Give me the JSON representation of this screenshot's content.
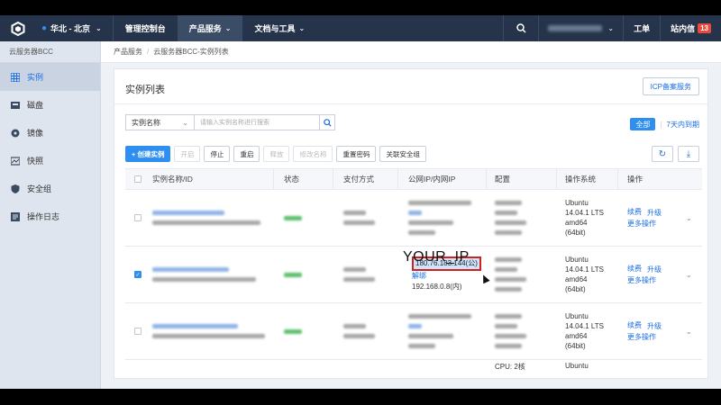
{
  "nav": {
    "region": "华北 - 北京",
    "items": [
      {
        "label": "管理控制台"
      },
      {
        "label": "产品服务"
      },
      {
        "label": "文档与工具"
      }
    ],
    "ticket": "工单",
    "messages": "站内信",
    "messages_count": "13"
  },
  "sidebar": {
    "title": "云服务器BCC",
    "items": [
      {
        "label": "实例",
        "icon": "grid-icon"
      },
      {
        "label": "磁盘",
        "icon": "disk-icon"
      },
      {
        "label": "镜像",
        "icon": "image-icon"
      },
      {
        "label": "快照",
        "icon": "snapshot-icon"
      },
      {
        "label": "安全组",
        "icon": "shield-icon"
      },
      {
        "label": "操作日志",
        "icon": "log-icon"
      }
    ]
  },
  "breadcrumb": {
    "root": "产品服务",
    "current": "云服务器BCC-实例列表"
  },
  "page": {
    "title": "实例列表",
    "icp_button": "ICP备案服务",
    "filter_select": "实例名称",
    "search_placeholder": "请输入实例名称进行搜索",
    "seg_all": "全部",
    "seg_expiring": "7天内到期"
  },
  "toolbar": {
    "create": "+ 创建实例",
    "start": "开启",
    "stop": "停止",
    "restart": "重启",
    "release": "释放",
    "rename": "修改名称",
    "reset_password": "重置密码",
    "security_group": "关联安全组"
  },
  "table": {
    "headers": [
      "实例名称/ID",
      "状态",
      "支付方式",
      "公网IP/内网IP",
      "配置",
      "操作系统",
      "操作"
    ],
    "rows": [
      {
        "os": [
          "Ubuntu",
          "14.04.1 LTS",
          "amd64",
          "(64bit)"
        ],
        "renew": "续费",
        "upgrade": "升级",
        "more": "更多操作",
        "checked": false
      },
      {
        "os": [
          "Ubuntu",
          "14.04.1 LTS",
          "amd64",
          "(64bit)"
        ],
        "renew": "续费",
        "upgrade": "升级",
        "more": "更多操作",
        "checked": true,
        "public_ip": "180.76.183.144(公)",
        "bind": "解绑",
        "private_ip": "192.168.0.8(内)"
      },
      {
        "os": [
          "Ubuntu",
          "14.04.1 LTS",
          "amd64",
          "(64bit)"
        ],
        "renew": "续费",
        "upgrade": "升级",
        "more": "更多操作",
        "checked": false
      }
    ],
    "partial_row": {
      "config": "CPU: 2核",
      "os": "Ubuntu"
    }
  },
  "annotation": "YOUR_IP",
  "colors": {
    "nav_bg": "#25344a",
    "accent": "#2f8ff0",
    "highlight_border": "#d02020"
  }
}
